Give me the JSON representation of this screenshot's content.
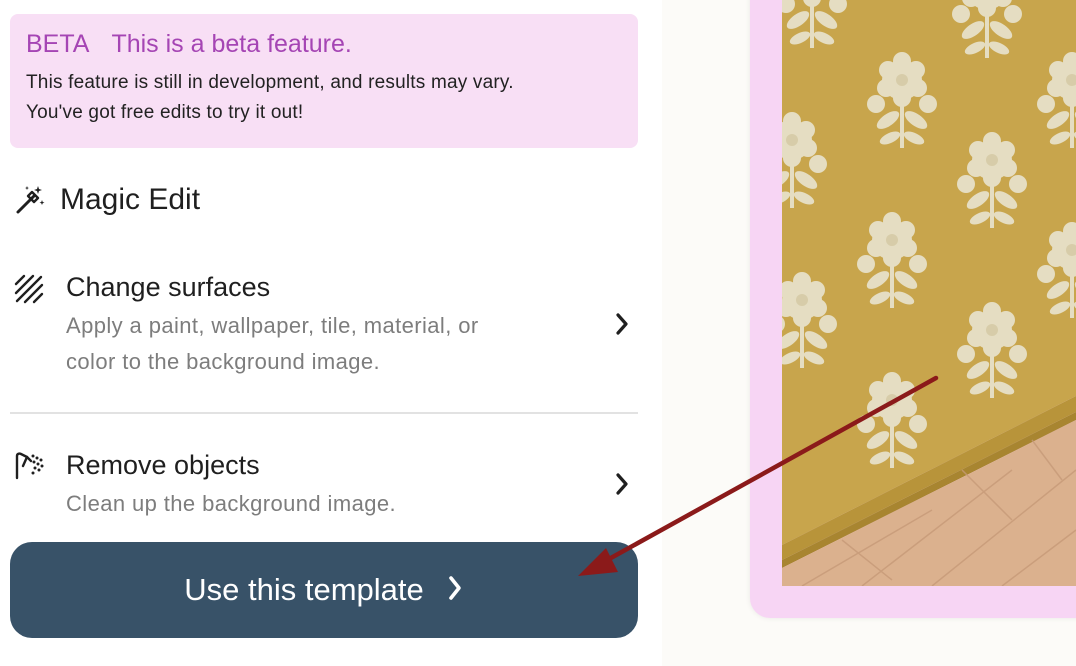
{
  "beta_banner": {
    "tag": "BETA",
    "title": "This is a beta feature.",
    "lines": [
      "This feature is still in development, and results may vary.",
      "You've got free edits to try it out!"
    ]
  },
  "magic_edit": {
    "title": "Magic Edit",
    "icon": "magic-wand-icon"
  },
  "options": [
    {
      "title": "Change surfaces",
      "description_lines": [
        "Apply a paint, wallpaper, tile, material, or",
        "color to the background image."
      ],
      "icon": "surface-hatch-icon"
    },
    {
      "title": "Remove objects",
      "description_lines": [
        "Clean up the background image."
      ],
      "icon": "eraser-brush-icon"
    }
  ],
  "cta": {
    "label": "Use this template",
    "icon": "chevron-right-icon"
  },
  "colors": {
    "beta_bg": "#f8dff5",
    "beta_accent": "#a545b4",
    "cta_bg": "#385268",
    "frame_pink": "#f7d5f4",
    "wallpaper": "#c9a84f",
    "floor": "#dcb28f",
    "annotation_arrow": "#8b1a1a"
  }
}
